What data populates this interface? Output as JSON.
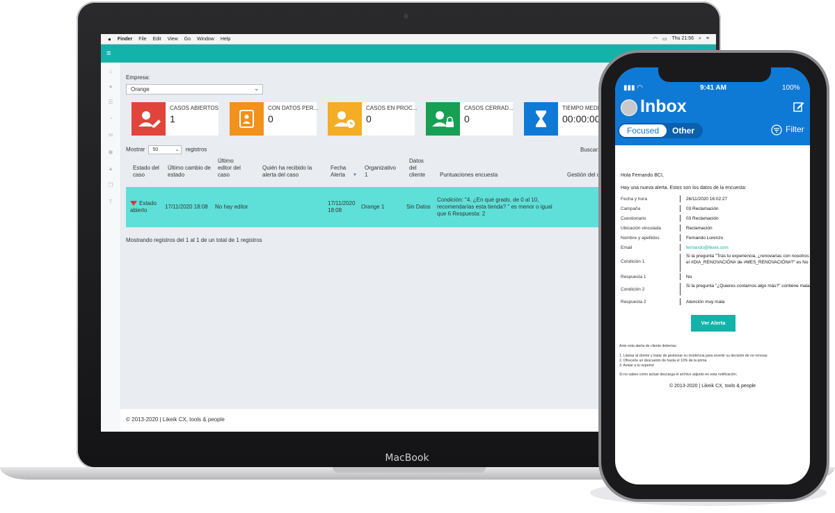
{
  "laptop": {
    "brand": "MacBook",
    "menubar": {
      "apple": "",
      "items": [
        "Finder",
        "File",
        "Edit",
        "View",
        "Go",
        "Window",
        "Help"
      ],
      "clock": "Thu 21:56"
    },
    "sidebar_icons": [
      "home-icon",
      "user-icon",
      "list-icon",
      "chart-icon",
      "mail-icon",
      "globe-icon",
      "bell-icon",
      "copy-icon",
      "text-icon"
    ],
    "empresa": {
      "label": "Empresa:",
      "value": "Orange"
    },
    "kpis": [
      {
        "title": "CASOS ABIERTOS",
        "value": "1",
        "color": "#e0443b"
      },
      {
        "title": "CON DATOS PER...",
        "value": "0",
        "color": "#f2911c"
      },
      {
        "title": "CASOS EN PROC...",
        "value": "0",
        "color": "#f5ad26"
      },
      {
        "title": "CASOS CERRAD...",
        "value": "0",
        "color": "#17a053"
      },
      {
        "title": "TIEMPO MEDIO D",
        "value": "00:00:00",
        "color": "#0f79d6"
      }
    ],
    "mostrar": {
      "label": "Mostrar",
      "value": "50",
      "suffix": "registros"
    },
    "buscar_label": "Buscar:",
    "table": {
      "headers": [
        "Estado del caso",
        "Último cambio de estado",
        "Último editor del caso",
        "Quién ha recibido la alerta del caso",
        "Fecha Alerta",
        "Organizativo 1",
        "Datos del cliente",
        "Puntuaciones encuesta",
        "Gestión del ca"
      ],
      "row": {
        "estado": "Estado abierto",
        "ultimo_cambio": "17/11/2020 18:08",
        "editor": "No hay editor",
        "fecha": "17/11/2020 18:08",
        "organizativo": "Orange 1",
        "datos": "Sin Datos",
        "puntuaciones": "Condición: \"4. ¿En qué grado, de 0 al 10, recomendarías esta tienda? \" es menor o igual que 6 Respuesta: 2"
      }
    },
    "showing": "Mostrando registros del 1 al 1 de un total de 1 registros",
    "footer": "© 2013-2020 | Likeik CX, tools & people"
  },
  "phone": {
    "status": {
      "time": "9:41 AM",
      "battery": "100%"
    },
    "title": "Inbox",
    "tabs": {
      "focused": "Focused",
      "other": "Other"
    },
    "filter": "Filter",
    "mail": {
      "greeting": "Hola Fernando BCI,",
      "intro": "Hay una nueva alerta. Estos son los datos de la encuesta:",
      "rows": [
        {
          "k": "Fecha y hora",
          "v": "26/11/2020 16:02:27"
        },
        {
          "k": "Campaña",
          "v": "03 Reclamación"
        },
        {
          "k": "Cuestionario",
          "v": "03 Reclamación"
        },
        {
          "k": "Ubicación vinculada",
          "v": "Reclamación"
        },
        {
          "k": "Nombre y apellidos",
          "v": "Fernando Lorenzo"
        },
        {
          "k": "Email",
          "v": "fernando@likeik.com"
        },
        {
          "k": "Condición 1",
          "v": "Si la pregunta \"Tras tu experiencia, ¿renovarías con nosotros el #DIA_RENOVACIÓN# de #MES_RENOVACIÓN#?\" es No"
        },
        {
          "k": "Respuesta 1",
          "v": "No"
        },
        {
          "k": "Condición 2",
          "v": "Si la pregunta \"¿Quieres contarnos algo más?\" contiene mala"
        },
        {
          "k": "Respuesta 2",
          "v": "Atención muy mala"
        }
      ],
      "button": "Ver Alerta",
      "advice_title": "Ante esta alerta de cliente deberías:",
      "advice": [
        "1. Llamar al cliente y tratar de gestionar su incidencia para revertir su decisión de no renovar.",
        "2. Ofrecerle un descuento de hasta el 10% de la prima",
        "3. Avisar a tu superior"
      ],
      "note": "Si no sabes como actuar descarga el archivo adjunto en esta notificación.",
      "copyright": "© 2013-2020 | Likeik CX, tools & people",
      "link_color": "#14b3a9"
    }
  }
}
